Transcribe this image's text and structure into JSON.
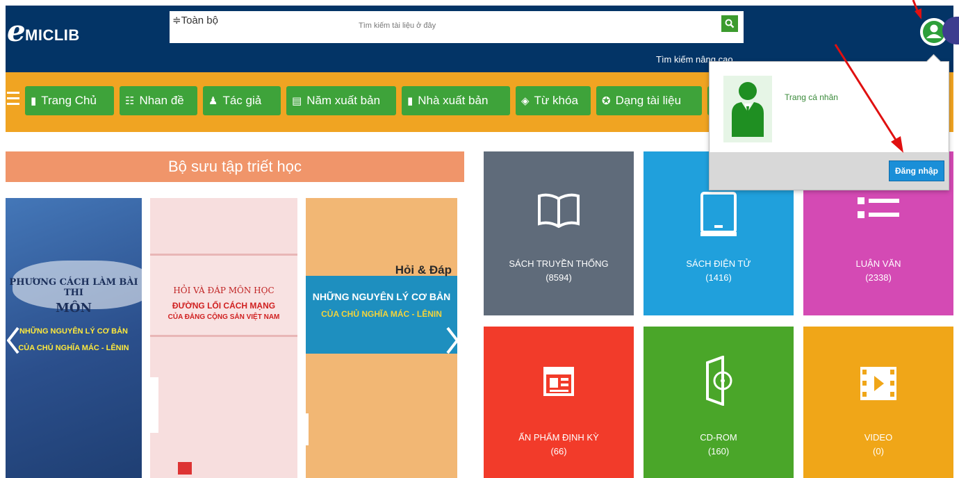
{
  "header": {
    "logo_mark": "e",
    "logo_text": "MICLIB",
    "search_scope": "≑Toàn bộ",
    "search_placeholder": "Tìm kiếm tài liệu ở đây",
    "advanced_search": "Tìm kiếm nâng cao",
    "colors": {
      "bg": "#033466",
      "search_button": "#3c9b2e"
    }
  },
  "nav": {
    "items": [
      {
        "label": "Trang Chủ",
        "icon": "book-icon"
      },
      {
        "label": "Nhan đề",
        "icon": "title-icon"
      },
      {
        "label": "Tác giả",
        "icon": "author-icon"
      },
      {
        "label": "Năm xuất bản",
        "icon": "calendar-icon"
      },
      {
        "label": "Nhà xuất bản",
        "icon": "bookmark-icon"
      },
      {
        "label": "Từ khóa",
        "icon": "keyword-icon"
      },
      {
        "label": "Dạng tài liệu",
        "icon": "doctype-icon"
      }
    ],
    "colors": {
      "bg": "#f0a422",
      "item": "#3ea33a"
    }
  },
  "collection": {
    "title": "Bộ sưu tập triết học",
    "books": [
      {
        "line1": "PHƯƠNG CÁCH LÀM BÀI THI",
        "line2": "MÔN",
        "line3": "NHỮNG NGUYÊN LÝ CƠ BẢN",
        "line4": "CỦA CHỦ NGHĨA MÁC - LÊNIN"
      },
      {
        "line1": "HỎI VÀ ĐÁP MÔN HỌC",
        "line2": "ĐƯỜNG LỐI CÁCH MẠNG",
        "line3": "CỦA ĐẢNG CỘNG SẢN VIỆT NAM"
      },
      {
        "line1": "Hỏi & Đáp",
        "line2": "NHỮNG NGUYÊN LÝ CƠ BẢN",
        "line3": "CỦA CHỦ NGHĨA MÁC - LÊNIN"
      }
    ]
  },
  "categories": [
    {
      "label": "SÁCH TRUYỀN THỐNG",
      "count": "(8594)",
      "color": "#5f6b7a",
      "icon": "open-book-icon"
    },
    {
      "label": "SÁCH ĐIỆN TỬ",
      "count": "(1416)",
      "color": "#20a0dc",
      "icon": "tablet-icon"
    },
    {
      "label": "LUẬN VĂN",
      "count": "(2338)",
      "color": "#d44ab4",
      "icon": "list-icon"
    },
    {
      "label": "ẤN PHẨM ĐỊNH KỲ",
      "count": "(66)",
      "color": "#f23b2a",
      "icon": "newspaper-icon"
    },
    {
      "label": "CD-ROM",
      "count": "(160)",
      "color": "#4aa629",
      "icon": "cd-icon"
    },
    {
      "label": "VIDEO",
      "count": "(0)",
      "color": "#f0a618",
      "icon": "film-icon"
    }
  ],
  "user_popup": {
    "profile_link": "Trang cá nhân",
    "login_button": "Đăng nhập"
  }
}
